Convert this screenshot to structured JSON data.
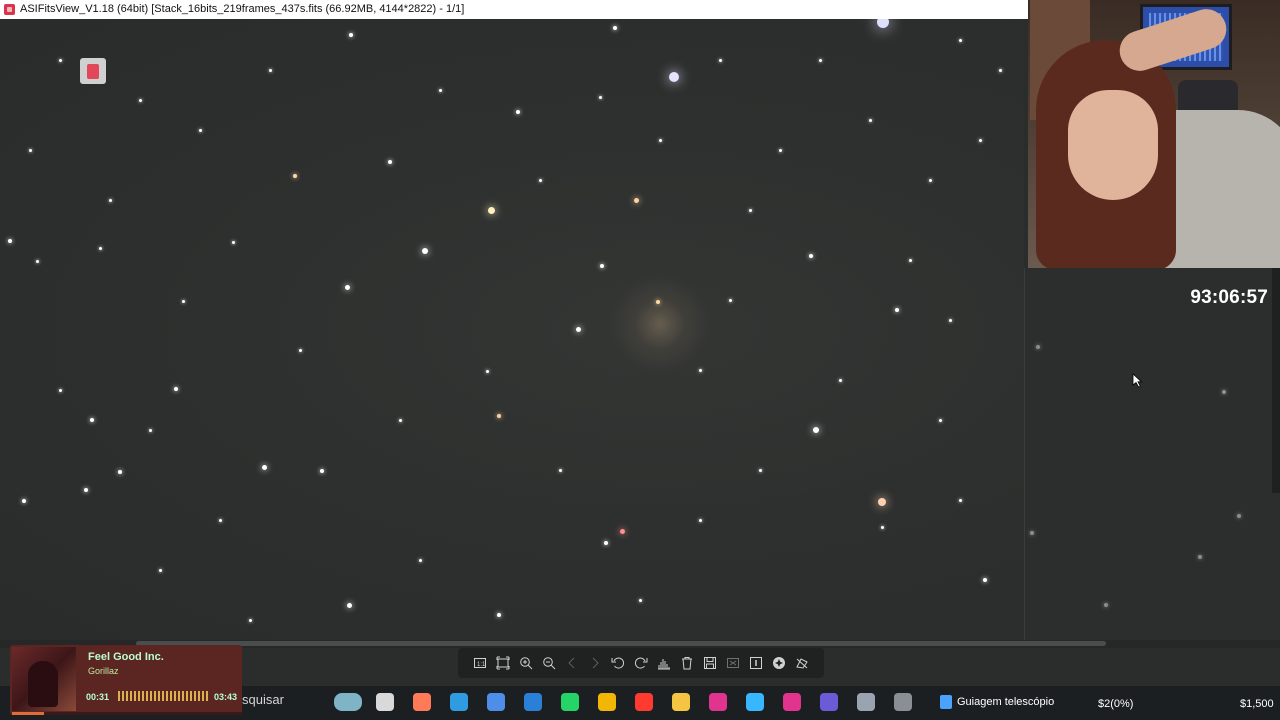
{
  "window": {
    "title": "ASIFitsView_V1.18 (64bit) [Stack_16bits_219frames_437s.fits (66.92MB, 4144*2822) - 1/1]"
  },
  "stream_overlay": {
    "timer": "93:06:57"
  },
  "viewer_toolbar": {
    "buttons": [
      {
        "name": "fit-1-1",
        "icon": "fit-actual-size-icon"
      },
      {
        "name": "fit-window",
        "icon": "fit-window-icon"
      },
      {
        "name": "zoom-in",
        "icon": "zoom-in-icon"
      },
      {
        "name": "zoom-out",
        "icon": "zoom-out-icon"
      },
      {
        "name": "previous",
        "icon": "previous-icon"
      },
      {
        "name": "next",
        "icon": "next-icon"
      },
      {
        "name": "rotate-left",
        "icon": "rotate-left-icon"
      },
      {
        "name": "rotate-right",
        "icon": "rotate-right-icon"
      },
      {
        "name": "histogram",
        "icon": "histogram-icon"
      },
      {
        "name": "delete",
        "icon": "trash-icon"
      },
      {
        "name": "save",
        "icon": "save-icon"
      },
      {
        "name": "crop",
        "icon": "crop-icon"
      },
      {
        "name": "info",
        "icon": "info-icon"
      },
      {
        "name": "stretch",
        "icon": "stretch-icon"
      },
      {
        "name": "annotate",
        "icon": "annotate-icon"
      }
    ]
  },
  "music_player": {
    "title": "Feel Good Inc.",
    "artist": "Gorillaz",
    "elapsed": "00:31",
    "duration": "03:43",
    "progress": 0.14
  },
  "taskbar": {
    "search_text": "squisar",
    "active_task": "Guiagem telescópio",
    "tray_left": "$2(0%)",
    "tray_right": "$1,500",
    "icons": [
      "landscape-icon",
      "file-explorer-icon",
      "copilot-icon",
      "edge-icon",
      "store-icon",
      "vpn-icon",
      "whatsapp-icon",
      "chrome-icon",
      "opera-icon",
      "folder-icon",
      "app-pink-icon",
      "refresh-app-icon",
      "app-pink2-icon",
      "stellarium-icon",
      "telescope-icon",
      "planet-icon"
    ]
  }
}
